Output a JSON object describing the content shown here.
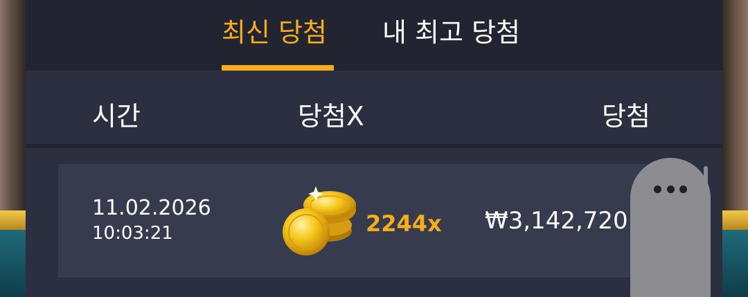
{
  "tabs": [
    {
      "label": "최신 당첨",
      "active": true
    },
    {
      "label": "내 최고 당첨",
      "active": false
    }
  ],
  "columns": {
    "time": "시간",
    "multiplier": "당첨X",
    "win": "당첨"
  },
  "rows": [
    {
      "date": "11.02.2026",
      "time": "10:03:21",
      "icon": "gold-coins-icon",
      "multiplier": "2244x",
      "win": "₩3,142,720.0"
    }
  ],
  "colors": {
    "accent": "#f5ad1e",
    "panel_bg": "#2c2f3f",
    "tabbar_bg": "#222431",
    "row_bg": "#363b4e",
    "more_button_bg": "#8d8d91"
  },
  "more_button": {
    "icon": "more-dots-icon"
  }
}
